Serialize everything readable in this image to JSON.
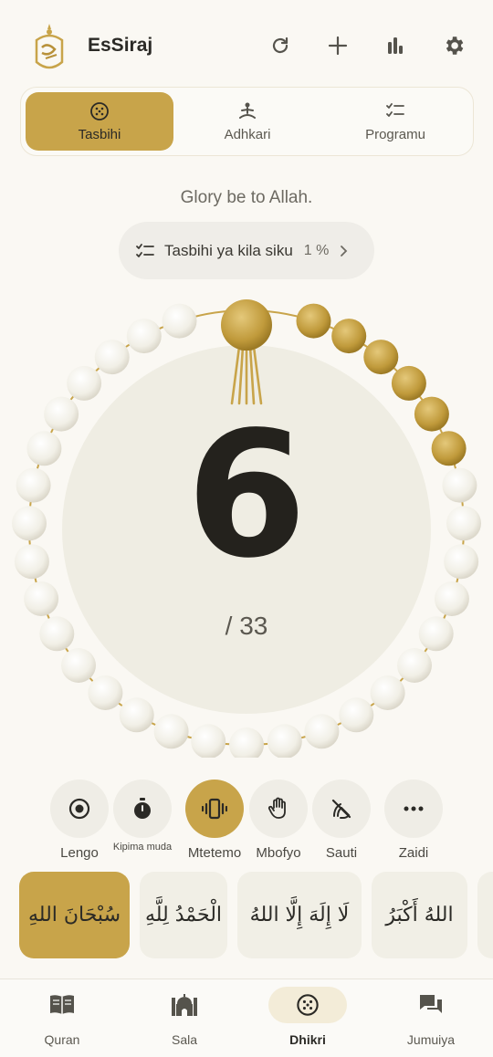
{
  "header": {
    "app_title": "EsSiraj",
    "icons": [
      "refresh-icon",
      "plus-icon",
      "stats-icon",
      "gear-icon"
    ]
  },
  "segments": [
    {
      "label": "Tasbihi",
      "icon": "beads-icon",
      "active": true
    },
    {
      "label": "Adhkari",
      "icon": "meditation-icon",
      "active": false
    },
    {
      "label": "Programu",
      "icon": "checklist-icon",
      "active": false
    }
  ],
  "dhikr_translation": "Glory be to Allah.",
  "daily_progress": {
    "label": "Tasbihi ya kila siku",
    "percent": "1 %"
  },
  "counter": {
    "count": "6",
    "total": "/ 33",
    "count_value": 6,
    "total_value": 33
  },
  "controls": [
    {
      "label": "Lengo",
      "icon": "target-icon",
      "active": false
    },
    {
      "label": "Kipima muda",
      "icon": "stopwatch-icon",
      "active": false
    },
    {
      "label": "Mtetemo",
      "icon": "vibration-icon",
      "active": true
    },
    {
      "label": "Mbofyo",
      "icon": "hand-icon",
      "active": false
    },
    {
      "label": "Sauti",
      "icon": "sound-off-icon",
      "active": false
    },
    {
      "label": "Zaidi",
      "icon": "more-icon",
      "active": false
    }
  ],
  "dhikr_cards": [
    {
      "text": "سُبْحَانَ اللهِ",
      "active": true
    },
    {
      "text": "الْحَمْدُ لِلَّهِ",
      "active": false
    },
    {
      "text": "لَا إِلَهَ إِلَّا اللهُ",
      "active": false
    },
    {
      "text": "اللهُ أَكْبَرُ",
      "active": false
    }
  ],
  "bottom_nav": [
    {
      "label": "Quran",
      "icon": "book-icon",
      "active": false
    },
    {
      "label": "Sala",
      "icon": "mosque-icon",
      "active": false
    },
    {
      "label": "Dhikri",
      "icon": "beads-icon",
      "active": true
    },
    {
      "label": "Jumuiya",
      "icon": "chat-icon",
      "active": false
    }
  ],
  "colors": {
    "accent": "#c8a44a",
    "background": "#faf8f3",
    "bead_light": "#f4f2ea",
    "bead_gold": "#c9a541"
  }
}
